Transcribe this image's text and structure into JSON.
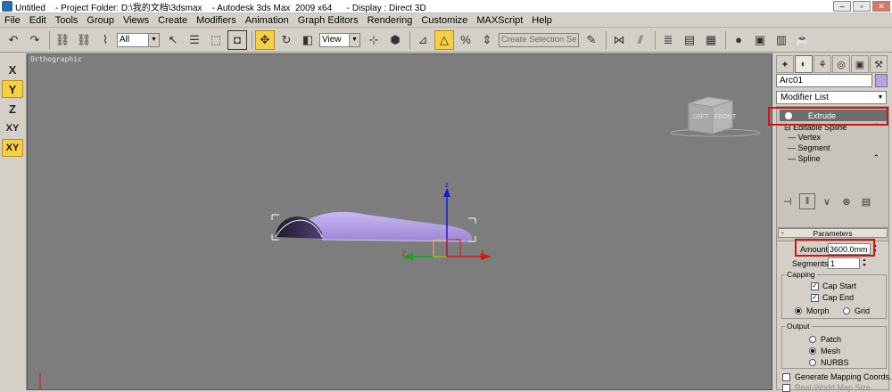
{
  "window": {
    "title": "Untitled    - Project Folder: D:\\我的文档\\3dsmax    - Autodesk 3ds Max  2009 x64      - Display : Direct 3D",
    "minimize": "–",
    "restore": "▫",
    "close": "✕"
  },
  "menu": [
    "File",
    "Edit",
    "Tools",
    "Group",
    "Views",
    "Create",
    "Modifiers",
    "Animation",
    "Graph Editors",
    "Rendering",
    "Customize",
    "MAXScript",
    "Help"
  ],
  "toolbar": {
    "selection_filter": "All",
    "reference_coord": "View",
    "named_selection_placeholder": "Create Selection Se"
  },
  "axis_constraints": [
    "X",
    "Y",
    "Z",
    "XY",
    "XY"
  ],
  "viewport": {
    "label": "Orthographic",
    "viewcube": {
      "left": "LEFT",
      "front": "FRONT"
    },
    "gizmo": {
      "x": "x",
      "y": "y",
      "z": "z"
    },
    "object_color": "#b7a1e8"
  },
  "command_panel": {
    "object_name": "Arc01",
    "object_color": "#b7a1e8",
    "modifier_list_label": "Modifier List",
    "stack": {
      "top": "Extrude",
      "base": "Editable Spline",
      "children": [
        "Vertex",
        "Segment",
        "Spline"
      ]
    },
    "parameters": {
      "title": "Parameters",
      "amount_label": "Amount:",
      "amount_value": "3600.0mm",
      "segments_label": "Segments:",
      "segments_value": "1",
      "capping": {
        "title": "Capping",
        "cap_start": "Cap Start",
        "cap_end": "Cap End",
        "morph": "Morph",
        "grid": "Grid"
      },
      "output": {
        "title": "Output",
        "patch": "Patch",
        "mesh": "Mesh",
        "nurbs": "NURBS"
      },
      "generate_mapping": "Generate Mapping Coords.",
      "real_world": "Real-World Map Size"
    }
  }
}
